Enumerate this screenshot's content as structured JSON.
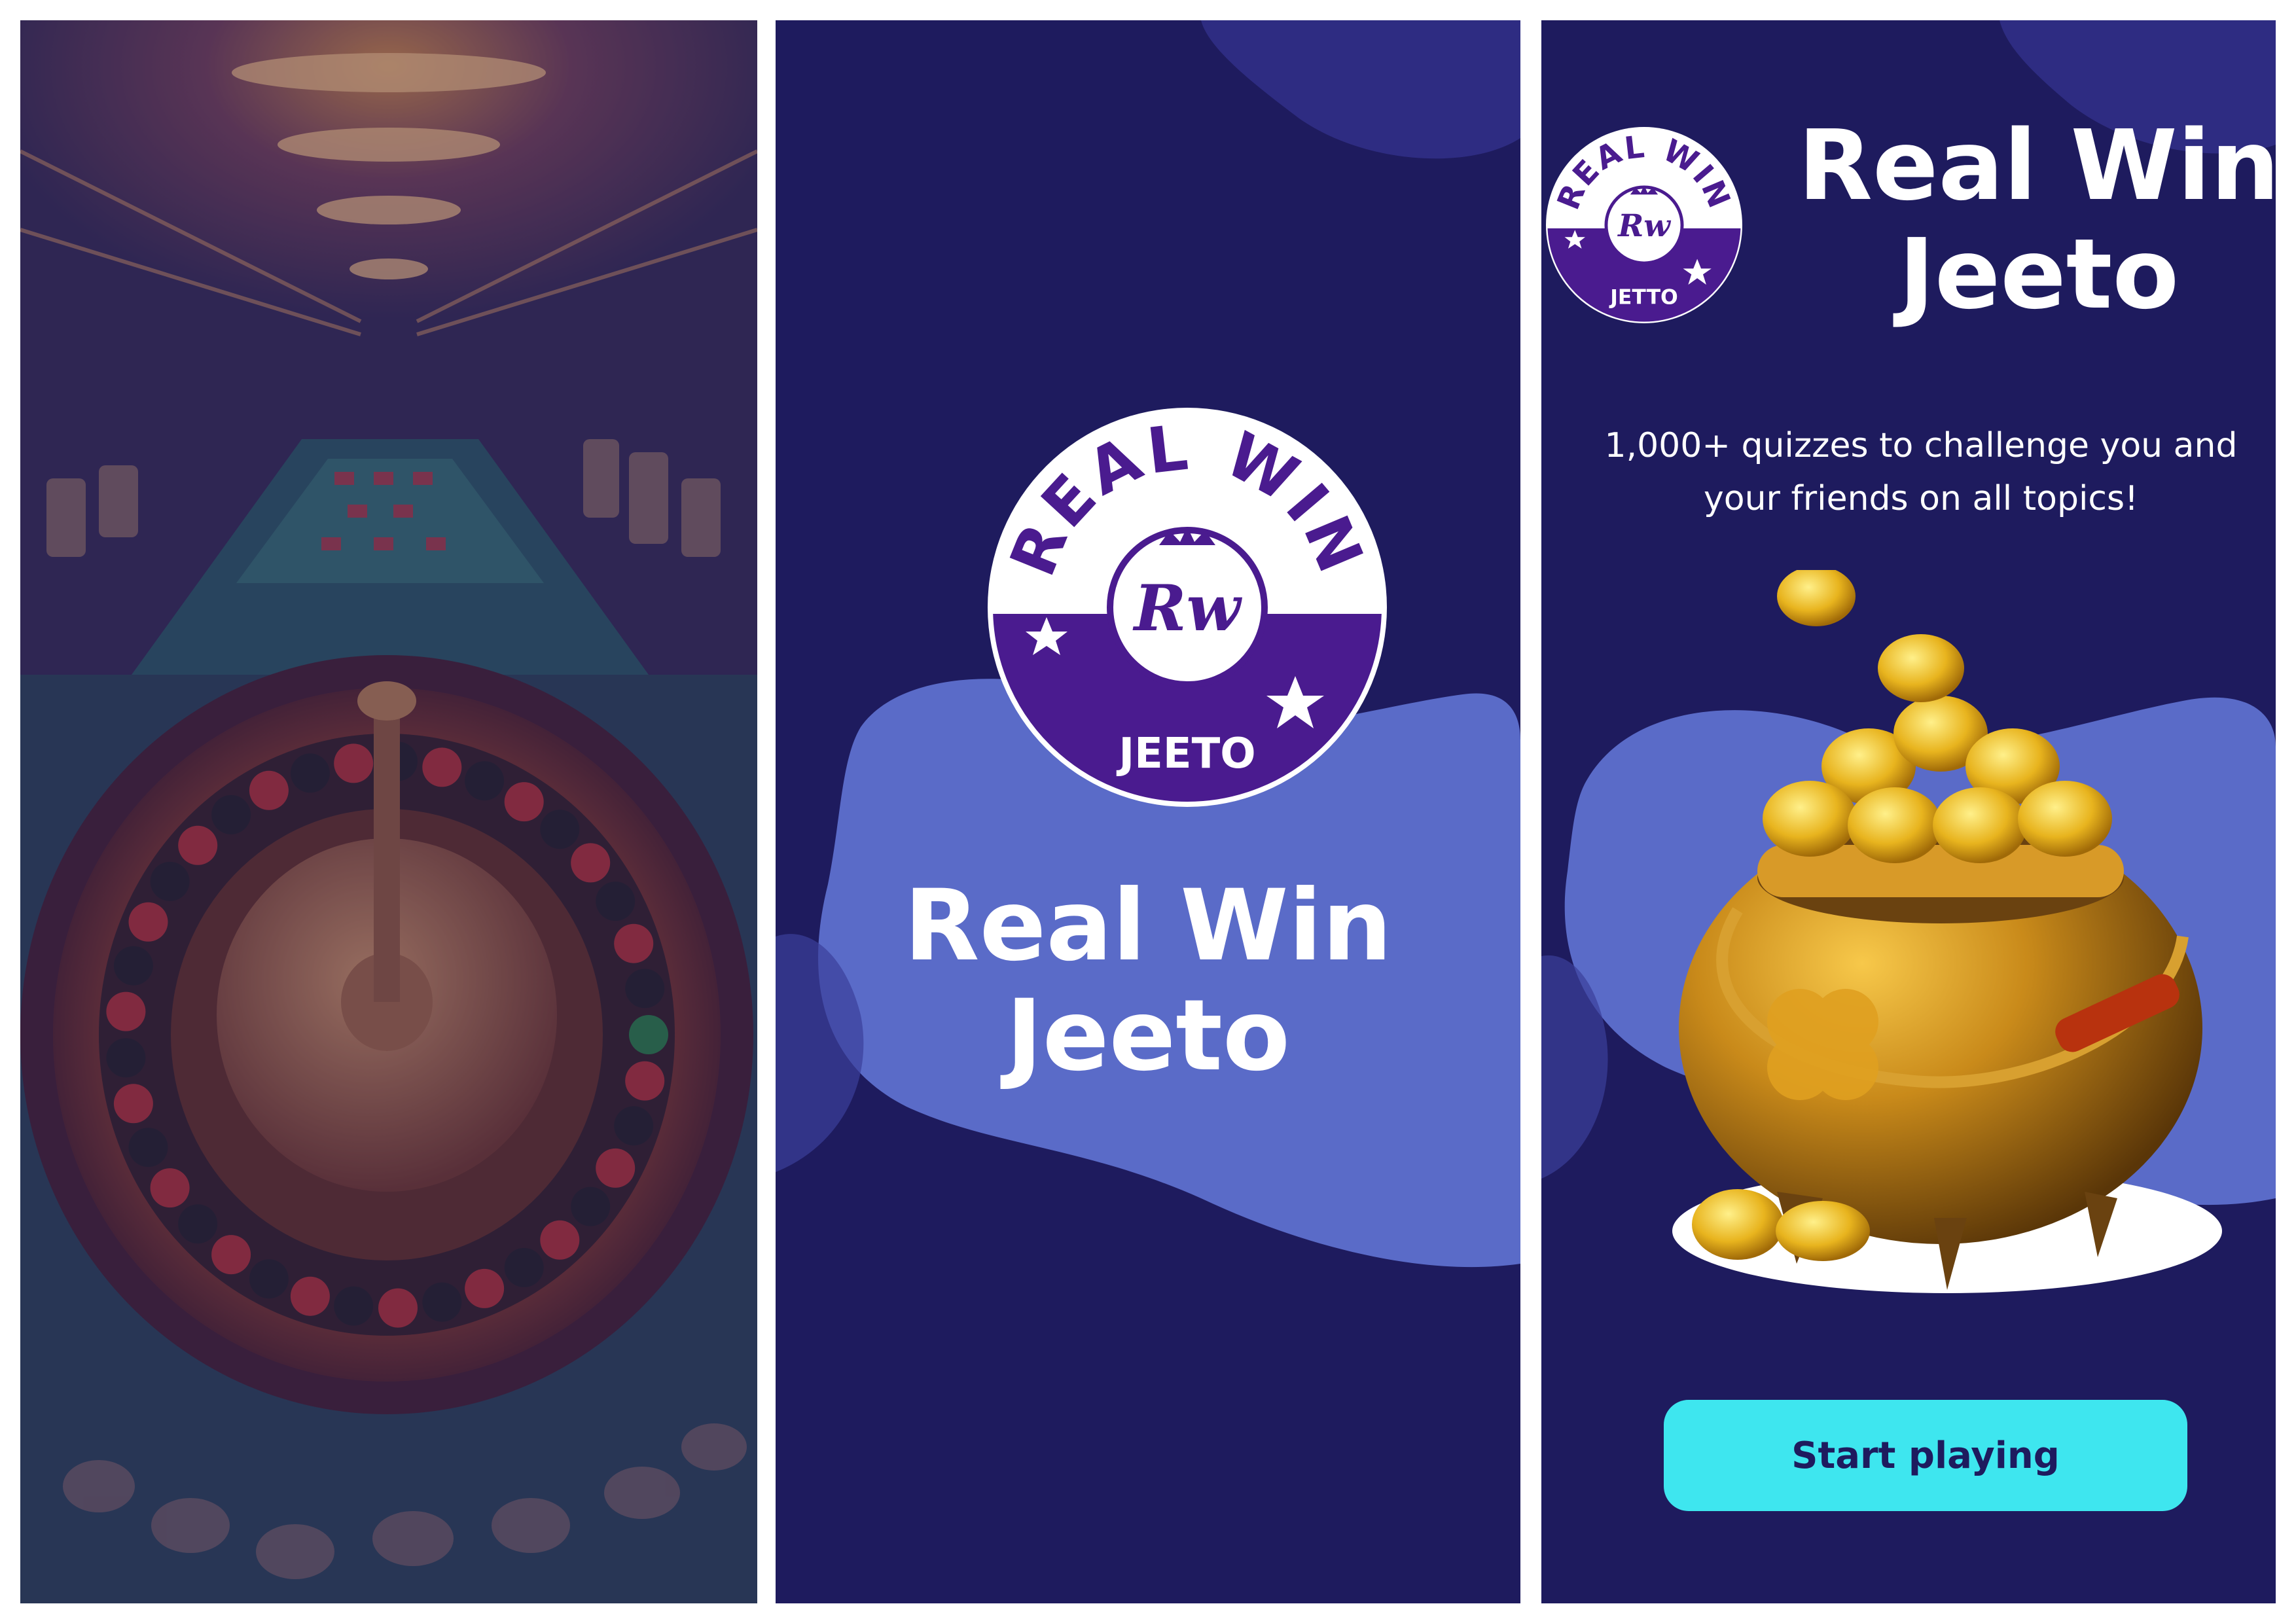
{
  "screens": {
    "screen1": {
      "image": "roulette-casino-background"
    },
    "screen2": {
      "logo": {
        "arc_text": "REAL WIN",
        "monogram": "Rw",
        "bottom_text": "JEETO"
      },
      "title_line1": "Real Win",
      "title_line2": "Jeeto"
    },
    "screen3": {
      "logo": {
        "arc_text": "REAL WIN",
        "monogram": "Rw",
        "bottom_text": "JETTO"
      },
      "title_line1": "Real Win",
      "title_line2": "Jeeto",
      "subtitle_line1": "1,000+ quizzes to challenge you and",
      "subtitle_line2": "your friends on all topics!",
      "illustration": "pot-of-gold-coins",
      "cta_label": "Start playing"
    }
  },
  "colors": {
    "background": "#1e1b5e",
    "blob": "#5a6bc8",
    "logo_purple": "#4a1b8f",
    "accent": "#3ee6ef"
  }
}
